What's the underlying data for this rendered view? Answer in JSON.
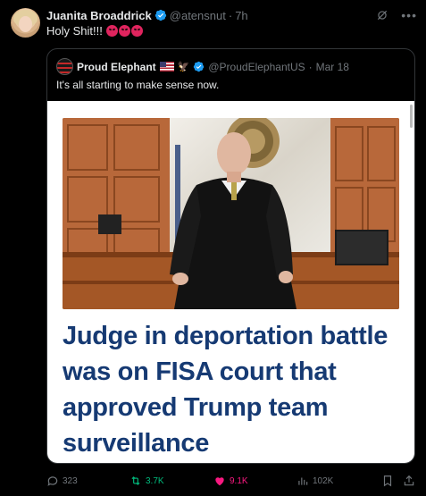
{
  "post": {
    "author_name": "Juanita Broaddrick",
    "handle": "@atensnut",
    "separator": "·",
    "time": "7h",
    "text": "Holy Shit!!!",
    "emojis": [
      "angry-face",
      "angry-face",
      "angry-face"
    ]
  },
  "quoted": {
    "author_name": "Proud Elephant",
    "badges": [
      "us-flag",
      "eagle"
    ],
    "handle": "@ProudElephantUS",
    "separator": "·",
    "date": "Mar 18",
    "text": "It's all starting to make sense now.",
    "headline": "Judge in deportation battle was on FISA court that approved Trump team surveillance"
  },
  "actions": {
    "replies": "323",
    "reposts": "3.7K",
    "likes": "9.1K",
    "views": "102K"
  },
  "colors": {
    "background": "#000000",
    "text": "#e7e9ea",
    "muted": "#71767b",
    "verified": "#1d9bf0",
    "repost_active": "#00ba7c",
    "like_active": "#f91880",
    "headline": "#163a73"
  }
}
